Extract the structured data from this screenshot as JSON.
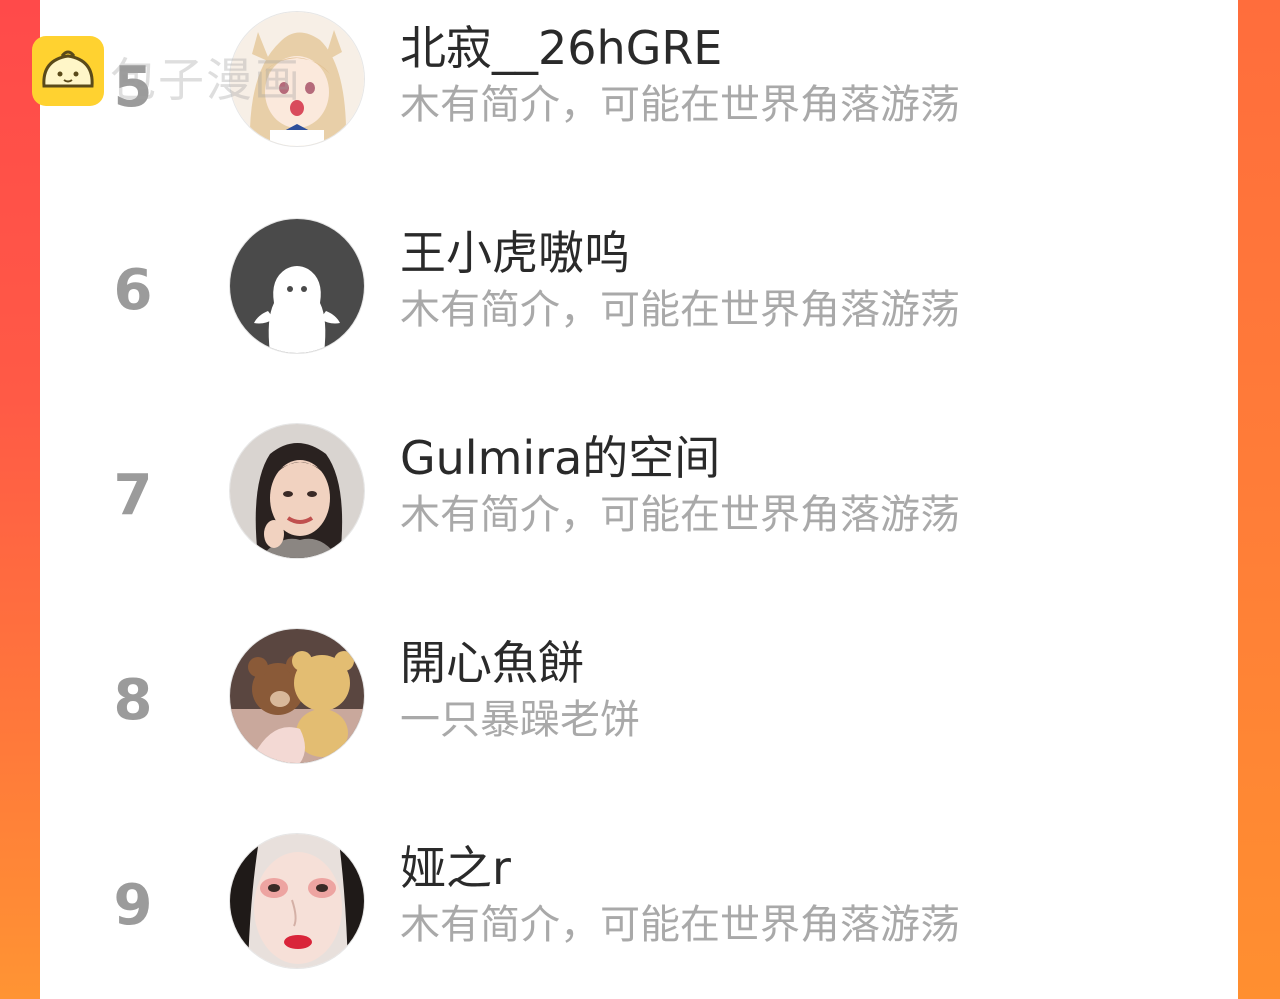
{
  "watermark": {
    "icon": "bun-logo-icon",
    "text": "包子漫画",
    "accent": "#ffd230"
  },
  "colors": {
    "background_gradient_top": "#ff4a4a",
    "background_gradient_bottom": "#ff9433",
    "panel": "#ffffff",
    "rank_text": "#9b9b9b",
    "name_text": "#2a2a2a",
    "bio_text": "#a9a9a9"
  },
  "users": [
    {
      "rank": "5",
      "name": "北寂__26hGRE",
      "bio": "木有简介，可能在世界角落游荡",
      "avatar": "anime-girl-avatar"
    },
    {
      "rank": "6",
      "name": "王小虎嗷呜",
      "bio": "木有简介，可能在世界角落游荡",
      "avatar": "default-ghost-avatar"
    },
    {
      "rank": "7",
      "name": "Gulmira的空间",
      "bio": "木有简介，可能在世界角落游荡",
      "avatar": "woman-photo-avatar"
    },
    {
      "rank": "8",
      "name": "開心魚餅",
      "bio": "一只暴躁老饼",
      "avatar": "teddy-bears-avatar"
    },
    {
      "rank": "9",
      "name": "娅之r",
      "bio": "木有简介，可能在世界角落游荡",
      "avatar": "girl-portrait-avatar"
    }
  ]
}
